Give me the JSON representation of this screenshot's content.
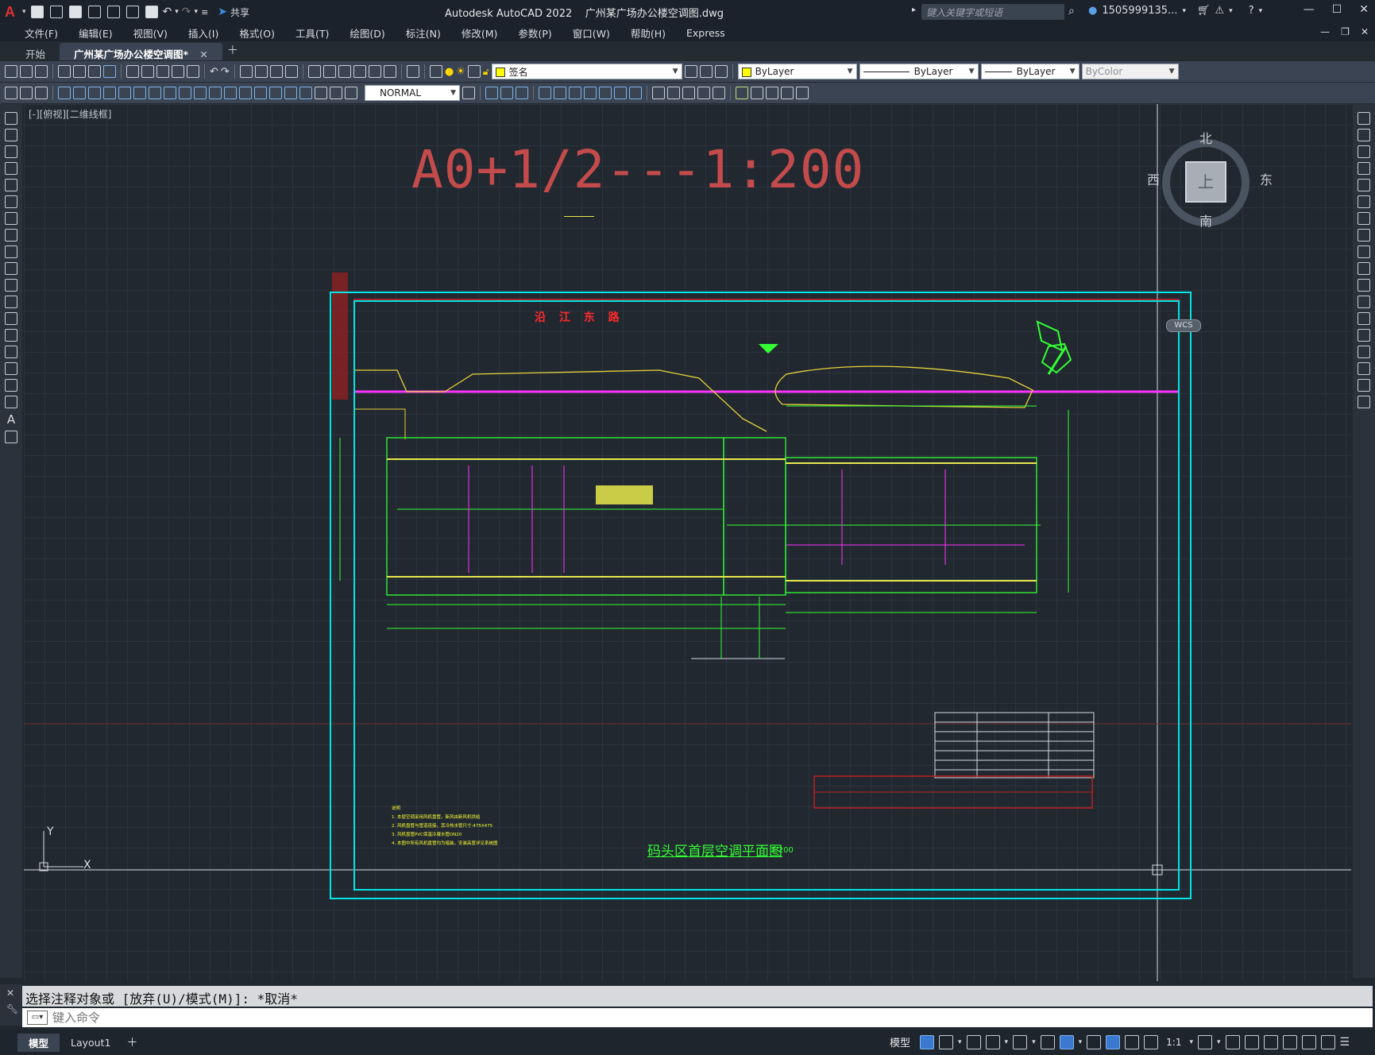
{
  "titlebar": {
    "app_title": "Autodesk AutoCAD 2022",
    "file_name": "广州某广场办公楼空调图.dwg",
    "share_label": "共享",
    "search_placeholder": "键入关键字或短语",
    "user_name": "1505999135..."
  },
  "menus": [
    "文件(F)",
    "编辑(E)",
    "视图(V)",
    "插入(I)",
    "格式(O)",
    "工具(T)",
    "绘图(D)",
    "标注(N)",
    "修改(M)",
    "参数(P)",
    "窗口(W)",
    "帮助(H)",
    "Express"
  ],
  "tabs": {
    "start": "开始",
    "drawing": "广州某广场办公楼空调图*"
  },
  "properties": {
    "layer": "签名",
    "color": "ByLayer",
    "linetype": "ByLayer",
    "lineweight": "ByLayer",
    "plotstyle": "ByColor",
    "dimstyle": "NORMAL"
  },
  "viewport": {
    "label": "[-][俯视][二维线框]",
    "scale_title": "A0+1/2---1:200",
    "road_label": "沿 江 东 路",
    "plan_title": "码头区首层空调平面图",
    "plan_scale": "1:200",
    "notes": [
      "说明",
      "1. 本层空调采用风机盘管，新风由新风机供给",
      "2. 风机盘管与管道连接，其冷热水管尺寸:475X475",
      "3. 风机盘管PVC保温冷凝水管DN20",
      "4. 本图中所有风机盘管均为暗装，安装高度详见系统图"
    ],
    "ucs_y": "Y",
    "ucs_x": "X"
  },
  "viewcube": {
    "north": "北",
    "south": "南",
    "west": "西",
    "east": "东",
    "face": "上",
    "wcs": "WCS"
  },
  "command": {
    "history": "选择注释对象或 [放弃(U)/模式(M)]: *取消*",
    "placeholder": "键入命令"
  },
  "status": {
    "layout_model": "模型",
    "layout1": "Layout1",
    "model_space": "模型",
    "annotation_scale": "1:1"
  },
  "colors": {
    "background": "#212830",
    "sheet_border": "#00e5e5",
    "wall_green": "#33ff33",
    "unit_yellow": "#ffff33",
    "pipe_magenta": "#ff33ff",
    "title_red": "#c34b4b"
  }
}
